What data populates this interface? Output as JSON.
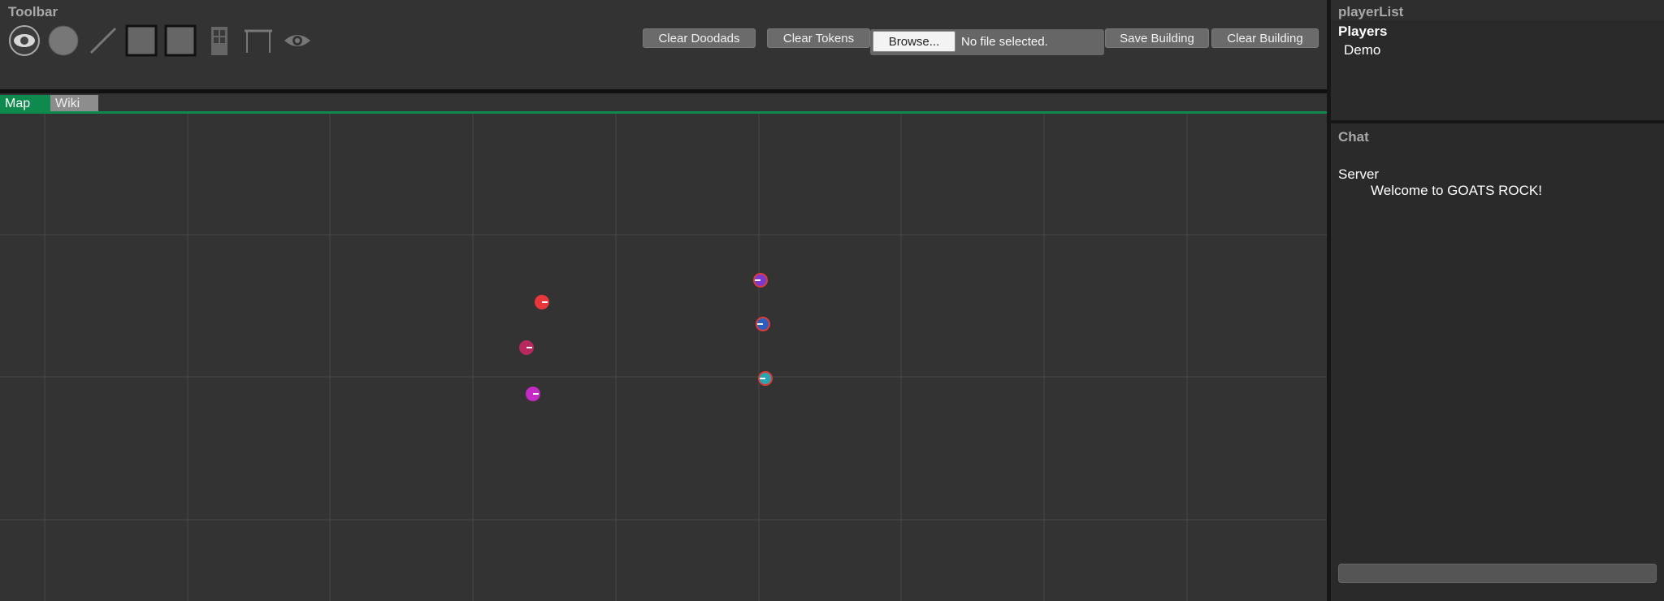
{
  "toolbar": {
    "title": "Toolbar",
    "tools": [
      "eye-icon",
      "circle-icon",
      "line-icon",
      "square-icon",
      "square-icon",
      "door-icon",
      "table-icon",
      "eye-icon"
    ],
    "clear_doodads_label": "Clear Doodads",
    "clear_tokens_label": "Clear Tokens",
    "browse_label": "Browse...",
    "file_status": "No file selected.",
    "save_building_label": "Save Building",
    "clear_building_label": "Clear Building"
  },
  "tabs": {
    "map": "Map",
    "wiki": "Wiki"
  },
  "map": {
    "tokens": [
      {
        "color": "#e8363a",
        "border": "#e8363a"
      },
      {
        "color": "#b8285e",
        "border": "#b8285e"
      },
      {
        "color": "#c42ac4",
        "border": "#c42ac4"
      },
      {
        "color": "#7a3ad0",
        "border": "#e03a3a"
      },
      {
        "color": "#2a5fc0",
        "border": "#e03a3a"
      },
      {
        "color": "#2aa6b0",
        "border": "#e03a3a"
      }
    ]
  },
  "player_list": {
    "title": "playerList",
    "heading": "Players",
    "players": [
      "Demo"
    ]
  },
  "chat": {
    "title": "Chat",
    "messages": [
      {
        "sender": "Server",
        "text": "Welcome to GOATS ROCK!"
      }
    ]
  },
  "colors": {
    "accent": "#0f8a4e",
    "background": "#333333",
    "panel": "#2a2a2a"
  }
}
